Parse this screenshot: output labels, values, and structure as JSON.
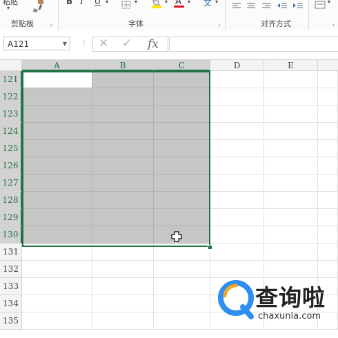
{
  "ribbon": {
    "clipboard_label": "剪贴板",
    "font_label": "字体",
    "alignment_label": "对齐方式",
    "paste_fragment": "粘贴",
    "bold": "B",
    "italic": "I",
    "underline": "U",
    "font_color_glyph": "A",
    "phonetic_glyph": "文",
    "launcher_glyph": "⌟"
  },
  "formula_bar": {
    "name_box_value": "A121",
    "cancel_glyph": "✕",
    "enter_glyph": "✓",
    "fx_glyph": "fx",
    "formula_value": ""
  },
  "sheet": {
    "columns": [
      "A",
      "B",
      "C",
      "D",
      "E"
    ],
    "rows": [
      "121",
      "122",
      "123",
      "124",
      "125",
      "126",
      "127",
      "128",
      "129",
      "130",
      "131",
      "132",
      "133",
      "134",
      "135"
    ],
    "selection": "A121:C130",
    "active_cell": "A121",
    "accent_color": "#217346"
  },
  "watermark": {
    "title": "查询啦",
    "url": "chaxunla.com"
  }
}
